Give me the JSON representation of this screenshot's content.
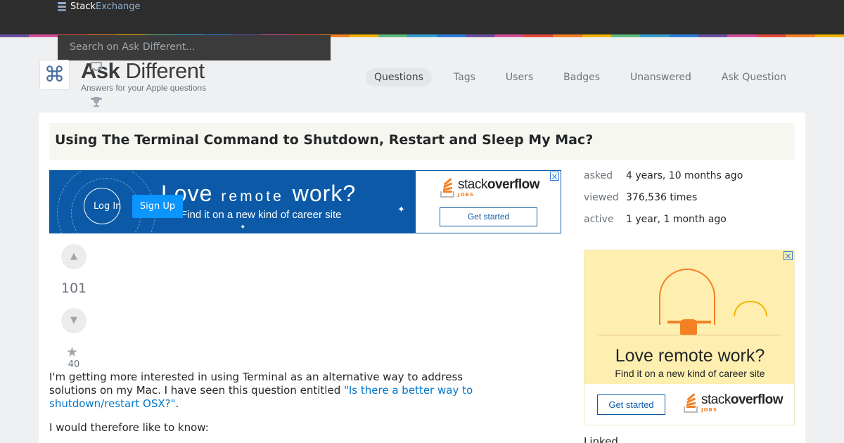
{
  "topbar": {
    "brand_part1": "Stack",
    "brand_part2": "Exchange",
    "search_placeholder": "Search on Ask Different..."
  },
  "rainbow_colors": [
    "#6c4fa0",
    "#d35097",
    "#e5493b",
    "#f48024",
    "#f5b400",
    "#5eba7d",
    "#35a0d0",
    "#2d7ed8",
    "#6c4fa0",
    "#d35097",
    "#e5493b",
    "#f48024",
    "#f5b400",
    "#5eba7d",
    "#35a0d0",
    "#2d7ed8",
    "#6c4fa0",
    "#d35097",
    "#e5493b",
    "#f48024",
    "#f5b400",
    "#5eba7d",
    "#35a0d0",
    "#2d7ed8",
    "#6c4fa0",
    "#d35097",
    "#e5493b",
    "#f48024",
    "#f5b400"
  ],
  "site": {
    "logo_symbol": "⌘",
    "title_bold": "Ask",
    "title_rest": " Different",
    "tagline": "Answers for your Apple questions"
  },
  "nav": {
    "questions": "Questions",
    "tags": "Tags",
    "users": "Users",
    "badges": "Badges",
    "unanswered": "Unanswered",
    "ask_question": "Ask Question"
  },
  "question": {
    "title": "Using The Terminal Command to Shutdown, Restart and Sleep My Mac?",
    "votes": "101",
    "favorites": "40",
    "body_p1_before": "I'm getting more interested in using Terminal as an alternative way to address solutions on my Mac. I have seen this question entitled ",
    "body_p1_link": "\"Is there a better way to shutdown/restart OSX?\"",
    "body_p1_after": ".",
    "body_p2": "I would therefore like to know:"
  },
  "auth": {
    "login": "Log In",
    "signup": "Sign Up"
  },
  "banner_ad": {
    "headline_1": "Love",
    "headline_2": "remote",
    "headline_3": "work?",
    "subline": "Find it on a new kind of career site",
    "brand_1": "stack",
    "brand_2": "overflow",
    "brand_jobs": "JOBS",
    "cta": "Get started"
  },
  "meta": {
    "asked_label": "asked",
    "asked_value": "4 years, 10 months ago",
    "viewed_label": "viewed",
    "viewed_value": "376,536 times",
    "active_label": "active",
    "active_value": "1 year, 1 month ago"
  },
  "side_ad": {
    "headline": "Love remote work?",
    "subline": "Find it on a new kind of career site",
    "cta": "Get started",
    "brand_1": "stack",
    "brand_2": "overflow",
    "brand_jobs": "JOBS"
  },
  "sidebar": {
    "linked_heading": "Linked"
  },
  "icons": {
    "up_arrow": "▲",
    "down_arrow": "▼",
    "star": "★",
    "trophy": "🏆",
    "help": "?",
    "close": "×",
    "sparkle": "✦"
  },
  "colors": {
    "topbar_bg": "#2d2d2d",
    "link": "#0077cc",
    "ad_blue": "#0c5aa7",
    "signup_bg": "#0a95ff",
    "so_orange": "#f48024"
  }
}
